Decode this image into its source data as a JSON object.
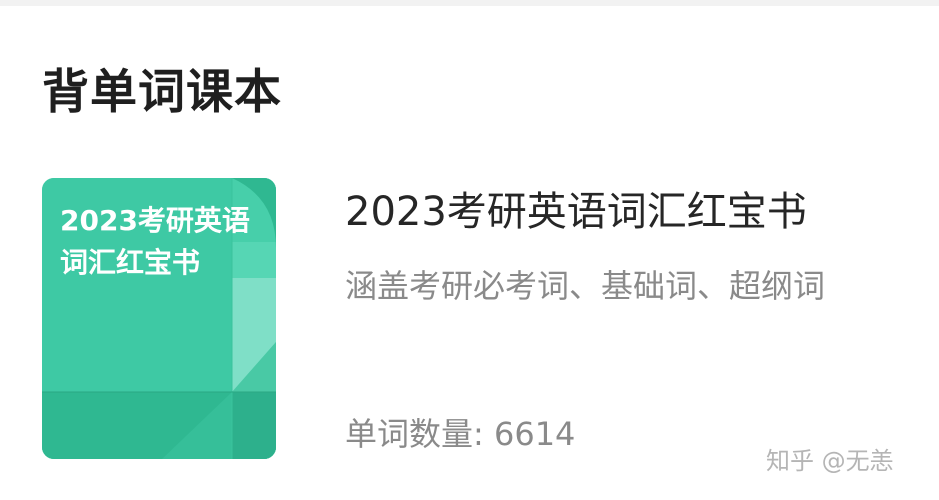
{
  "section": {
    "title": "背单词课本"
  },
  "book": {
    "cover_line1": "2023考研英语",
    "cover_line2": "词汇红宝书",
    "title": "2023考研英语词汇红宝书",
    "description": "涵盖考研必考词、基础词、超纲词",
    "count_label": "单词数量:",
    "count_value": "6614"
  },
  "watermark": {
    "text": "知乎 @无恙"
  },
  "colors": {
    "cover_main": "#3ec9a4",
    "cover_dark": "#2fb891",
    "cover_light": "#7fdfc7",
    "title_text": "#1f1f1f",
    "secondary_text": "#8a8a8a"
  }
}
